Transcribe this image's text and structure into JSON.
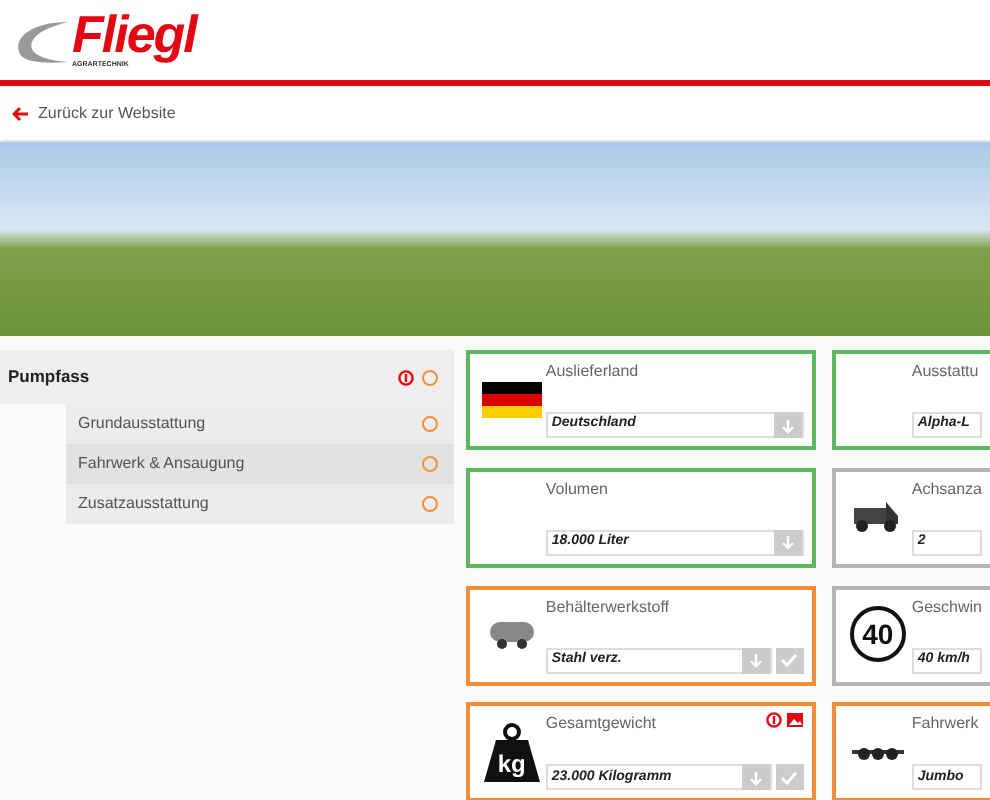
{
  "header": {
    "logo_text": "Fliegl",
    "logo_subtext": "AGRARTECHNIK"
  },
  "back_link": {
    "label": "Zurück zur Website"
  },
  "sidebar": {
    "items": [
      {
        "label": "Pumpfass",
        "alert": true,
        "children": [
          {
            "label": "Grundausstattung",
            "alert": false
          },
          {
            "label": "Fahrwerk & Ansaugung",
            "alert": false
          },
          {
            "label": "Zusatzausstattung",
            "alert": false
          }
        ]
      }
    ]
  },
  "options": [
    {
      "kind": "flag",
      "label": "Auslieferland",
      "value": "Deutschland",
      "color": "#5cb85c",
      "confirm": false,
      "alerts": false
    },
    {
      "kind": "plain",
      "label": "Ausstattu",
      "value": "Alpha-L",
      "color": "#5cb85c",
      "confirm": false,
      "alerts": false
    },
    {
      "kind": "plain",
      "label": "Volumen",
      "value": "18.000 Liter",
      "color": "#5cb85c",
      "confirm": false,
      "alerts": false
    },
    {
      "kind": "vehicle",
      "label": "Achsanza",
      "value": "2",
      "color": "#b5b5b5",
      "confirm": false,
      "alerts": false
    },
    {
      "kind": "tank",
      "label": "Behälterwerkstoff",
      "value": "Stahl verz.",
      "color": "#f68b38",
      "confirm": true,
      "alerts": false
    },
    {
      "kind": "speed",
      "label": "Geschwin",
      "value": "40 km/h",
      "color": "#b5b5b5",
      "icon_text": "40",
      "confirm": false,
      "alerts": false
    },
    {
      "kind": "weight",
      "label": "Gesamtgewicht",
      "value": "23.000 Kilogramm",
      "color": "#f68b38",
      "icon_text": "kg",
      "confirm": true,
      "alerts": true
    },
    {
      "kind": "chassis",
      "label": "Fahrwerk",
      "value": "Jumbo",
      "color": "#f68b38",
      "confirm": false,
      "alerts": false
    }
  ]
}
